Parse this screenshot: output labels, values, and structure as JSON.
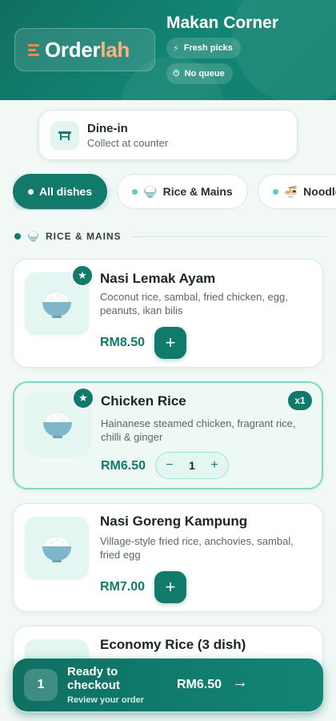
{
  "brand": {
    "logo_text_main": "Order",
    "logo_text_accent": "lah",
    "store_name": "Makan Corner",
    "pills": [
      {
        "label": "Fresh picks",
        "icon": "bolt-icon"
      },
      {
        "label": "No queue",
        "icon": "timer-icon"
      }
    ]
  },
  "order_mode": {
    "title": "Dine-in",
    "subtitle": "Collect at counter",
    "icon": "table-icon"
  },
  "categories": [
    {
      "label": "All dishes",
      "active": true
    },
    {
      "label": "Rice & Mains",
      "emoji": "🍚",
      "active": false
    },
    {
      "label": "Noodles",
      "emoji": "🍜",
      "active": false
    }
  ],
  "section": {
    "emoji": "🍚",
    "title": "RICE & MAINS"
  },
  "dishes": [
    {
      "name": "Nasi Lemak Ayam",
      "description": "Coconut rice, sambal, fried chicken, egg, peanuts, ikan bilis",
      "price": "RM8.50",
      "featured": true,
      "emoji": "🍚"
    },
    {
      "name": "Chicken Rice",
      "description": "Hainanese steamed chicken, fragrant rice, chilli & ginger",
      "price": "RM6.50",
      "featured": true,
      "quantity": "1",
      "qty_badge": "x1",
      "emoji": "🍚"
    },
    {
      "name": "Nasi Goreng Kampung",
      "description": "Village-style fried rice, anchovies, sambal, fried egg",
      "price": "RM7.00",
      "featured": false,
      "emoji": "🍚"
    },
    {
      "name": "Economy Rice (3 dish)",
      "featured": false
    }
  ],
  "checkout": {
    "count": "1",
    "title": "Ready to checkout",
    "subtitle": "Review your order",
    "total": "RM6.50"
  },
  "colors": {
    "brand": "#117a6b",
    "accent": "#ff8a3d",
    "background": "#f1f8f6"
  }
}
